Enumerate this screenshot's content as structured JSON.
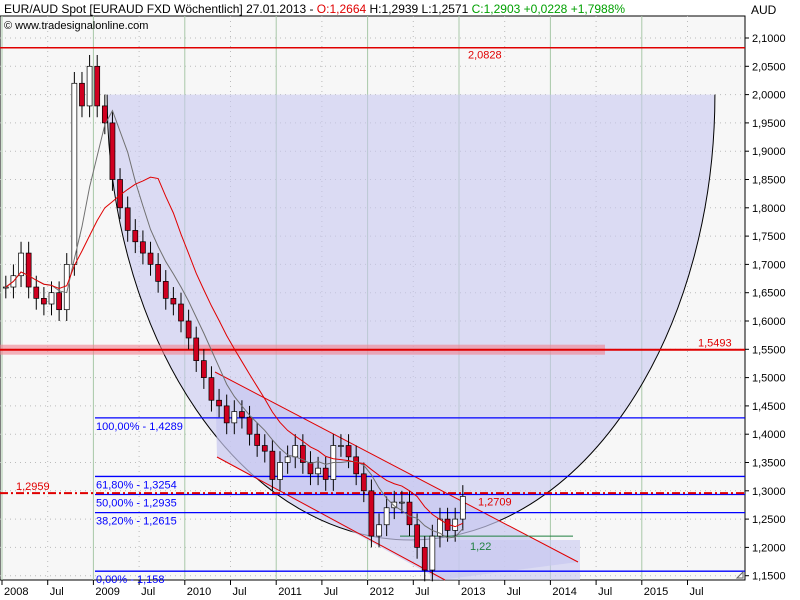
{
  "header": {
    "symbol": "EUR/AUD Spot [EURAUD FXD  Wöchentlich] 27.01.2013 -",
    "open": "O:1,2664",
    "hl": "H:1,2939 L:1,2571",
    "close": "C:1,2903 +0,0228 +1,7988%",
    "copyright": "© www.tradesignalonline.com"
  },
  "chart_data": {
    "type": "candlestick",
    "ylabel": "AUD",
    "ylim": [
      1.15,
      2.1
    ],
    "yticks": [
      "2,1000",
      "2,0500",
      "2,0000",
      "1,9500",
      "1,9000",
      "1,8500",
      "1,8000",
      "1,7500",
      "1,7000",
      "1,6500",
      "1,6000",
      "1,5500",
      "1,5000",
      "1,4500",
      "1,4000",
      "1,3500",
      "1,3000",
      "1,2500",
      "1,2000",
      "1,1500"
    ],
    "xticks": [
      {
        "label": "2008",
        "t": 2008
      },
      {
        "label": "Jul",
        "t": 2008.5
      },
      {
        "label": "2009",
        "t": 2009
      },
      {
        "label": "Jul",
        "t": 2009.5
      },
      {
        "label": "2010",
        "t": 2010
      },
      {
        "label": "Jul",
        "t": 2010.5
      },
      {
        "label": "2011",
        "t": 2011
      },
      {
        "label": "Jul",
        "t": 2011.5
      },
      {
        "label": "2012",
        "t": 2012
      },
      {
        "label": "Jul",
        "t": 2012.5
      },
      {
        "label": "2013",
        "t": 2013
      },
      {
        "label": "Jul",
        "t": 2013.5
      },
      {
        "label": "2014",
        "t": 2014
      },
      {
        "label": "Jul",
        "t": 2014.5
      },
      {
        "label": "2015",
        "t": 2015
      },
      {
        "label": "Jul",
        "t": 2015.5
      }
    ],
    "start": "2008-01",
    "frequency": "monthly",
    "closes": [
      1.66,
      1.68,
      1.72,
      1.66,
      1.64,
      1.63,
      1.65,
      1.62,
      1.7,
      2.02,
      1.98,
      2.05,
      1.98,
      1.95,
      1.85,
      1.8,
      1.76,
      1.74,
      1.72,
      1.7,
      1.67,
      1.64,
      1.63,
      1.6,
      1.57,
      1.53,
      1.5,
      1.46,
      1.45,
      1.42,
      1.44,
      1.43,
      1.4,
      1.38,
      1.37,
      1.32,
      1.35,
      1.36,
      1.38,
      1.35,
      1.33,
      1.34,
      1.32,
      1.38,
      1.38,
      1.36,
      1.33,
      1.3,
      1.22,
      1.24,
      1.27,
      1.28,
      1.28,
      1.24,
      1.2,
      1.16,
      1.22,
      1.25,
      1.23,
      1.25,
      1.29
    ],
    "moving_averages": [
      {
        "periods": 6,
        "color": "#707070"
      },
      {
        "periods": 12,
        "color": "#e00000"
      }
    ],
    "levels": [
      {
        "value": 2.0828,
        "label": "2,0828",
        "color": "#e00000",
        "style": "solid"
      },
      {
        "value": 1.5493,
        "label": "1,5493",
        "color": "#e00000",
        "style": "band"
      },
      {
        "value": 1.2959,
        "label": "1,2959",
        "color": "#e00000",
        "style": "dashdot"
      },
      {
        "value": 1.22,
        "label": "1,22",
        "color": "#208040",
        "style": "solid"
      }
    ],
    "annotation": {
      "value": 1.2709,
      "label": "1,2709"
    },
    "fibonacci": [
      {
        "value": 1.4289,
        "label": "100,00% - 1,4289"
      },
      {
        "value": 1.3254,
        "label": "61,80% - 1,3254"
      },
      {
        "value": 1.2935,
        "label": "50,00% - 1,2935"
      },
      {
        "value": 1.2615,
        "label": "38,20% - 1,2615"
      },
      {
        "value": 1.158,
        "label": "0,00% - 1,158"
      }
    ],
    "colors": {
      "up": "#ffffff",
      "down": "#d00020",
      "fib": "#0000ff",
      "shade": "#c8c8f0",
      "background": "#f7f7f7"
    }
  }
}
